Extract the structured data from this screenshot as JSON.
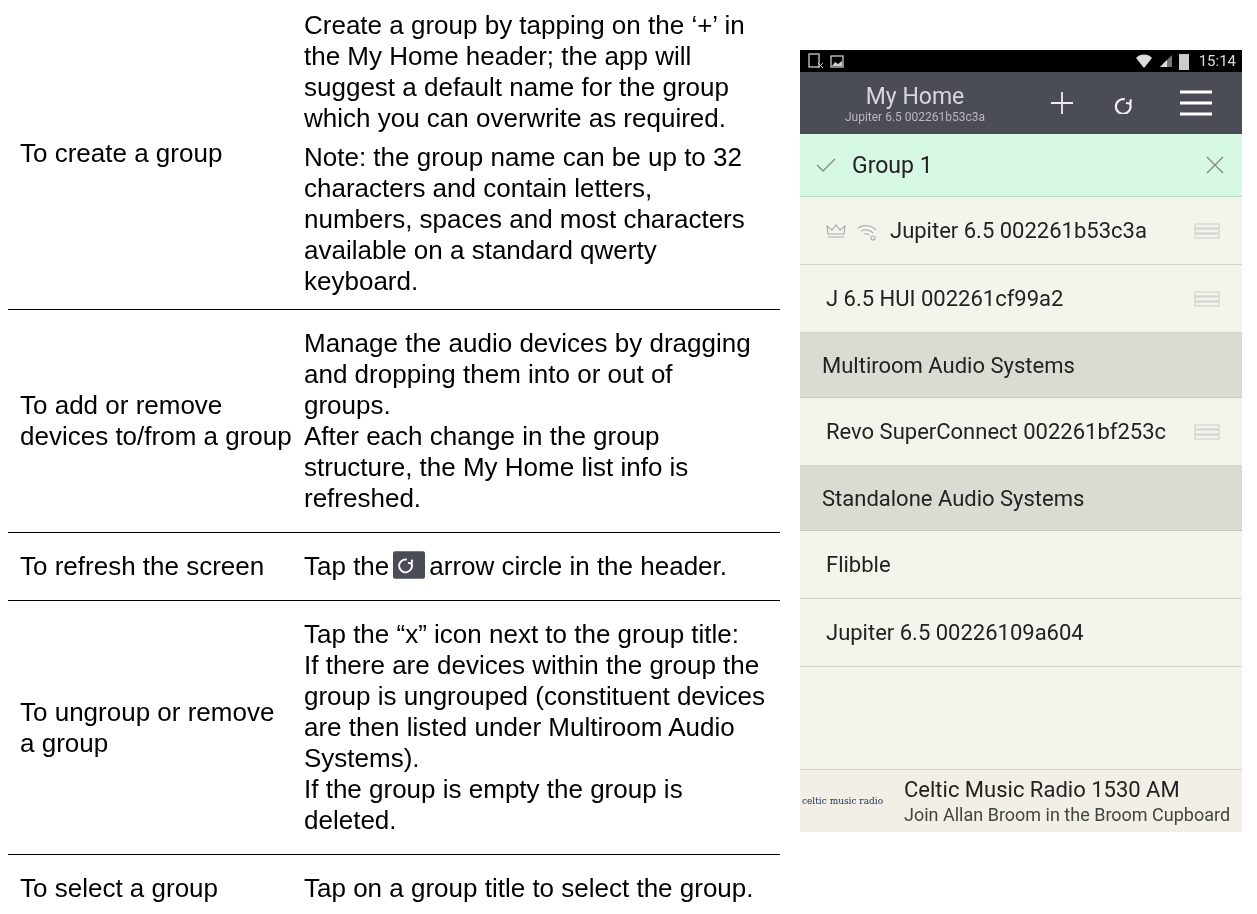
{
  "table": {
    "rows": [
      {
        "task": "To create a group",
        "paragraphs": [
          {
            "kind": "text",
            "text": "Create a group by tapping on the ‘+’ in the My Home header; the app will suggest a default name for the group which you can overwrite as required.",
            "gap": false
          },
          {
            "kind": "text",
            "text": "Note: the group name can be up to 32 characters and contain letters, numbers, spaces and most characters available on a standard qwerty keyboard.",
            "gap": true
          }
        ]
      },
      {
        "task": "To add or remove devices to/from a group",
        "paragraphs": [
          {
            "kind": "text",
            "text": "Manage the audio devices by dragging and dropping them into or out of groups.",
            "gap": false
          },
          {
            "kind": "text",
            "text": "After each change in the group structure, the My Home list info is refreshed.",
            "gap": false
          }
        ]
      },
      {
        "task": "To refresh the screen",
        "paragraphs": [
          {
            "kind": "icon_text",
            "before": "Tap the",
            "after": "arrow circle in the header.",
            "gap": false
          }
        ]
      },
      {
        "task": "To ungroup or remove a group",
        "paragraphs": [
          {
            "kind": "text",
            "text": "Tap the “x” icon next to the group title:",
            "gap": false
          },
          {
            "kind": "text",
            "text": "If there are devices within the group the group is ungrouped (constituent devices are then listed under Multiroom Audio Systems).",
            "gap": false
          },
          {
            "kind": "text",
            "text": "If the group is empty the group is deleted.",
            "gap": false
          }
        ]
      },
      {
        "task": "To select a group",
        "paragraphs": [
          {
            "kind": "text",
            "text": "Tap on a group title to select the group.",
            "gap": false
          }
        ]
      }
    ]
  },
  "phone": {
    "status_bar": {
      "time": "15:14"
    },
    "header": {
      "title": "My Home",
      "subtitle": "Jupiter 6.5 002261b53c3a"
    },
    "list": [
      {
        "kind": "group",
        "label": "Group 1",
        "selected": true
      },
      {
        "kind": "device",
        "label": "Jupiter 6.5 002261b53c3a",
        "master": true,
        "draggable": true
      },
      {
        "kind": "device",
        "label": "J 6.5 HUI 002261cf99a2",
        "master": false,
        "draggable": true
      },
      {
        "kind": "section",
        "label": "Multiroom Audio Systems"
      },
      {
        "kind": "device",
        "label": "Revo SuperConnect 002261bf253c",
        "master": false,
        "draggable": true
      },
      {
        "kind": "section",
        "label": "Standalone Audio Systems"
      },
      {
        "kind": "device",
        "label": "Flibble",
        "master": false,
        "draggable": false
      },
      {
        "kind": "device",
        "label": "Jupiter 6.5 00226109a604",
        "master": false,
        "draggable": false
      }
    ],
    "player": {
      "logo_text": "celtic music radio",
      "title": "Celtic Music Radio 1530 AM",
      "subtitle": "Join Allan Broom in the Broom Cupboard"
    }
  }
}
